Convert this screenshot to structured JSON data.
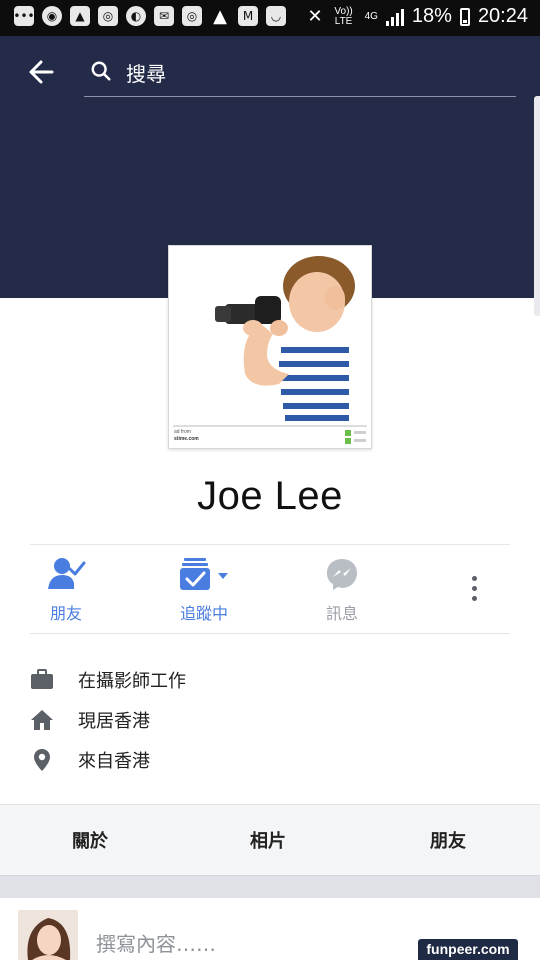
{
  "status_bar": {
    "volte": "Vo)) LTE",
    "network": "4G",
    "battery": "18%",
    "time": "20:24"
  },
  "header": {
    "search_placeholder": "搜尋"
  },
  "profile": {
    "name": "Joe Lee",
    "photo_caption_line1": "ad from",
    "photo_caption_line2": "stime.com"
  },
  "actions": {
    "friends": "朋友",
    "following": "追蹤中",
    "message": "訊息"
  },
  "info": {
    "work": "在攝影師工作",
    "lives": "現居香港",
    "from": "來自香港"
  },
  "tabs": {
    "about": "關於",
    "photos": "相片",
    "friends": "朋友"
  },
  "composer": {
    "placeholder": "撰寫內容……"
  },
  "watermark": "funpeer.com",
  "colors": {
    "cover": "#232b48",
    "accent": "#4a7de0",
    "muted": "#9a9ea6"
  }
}
